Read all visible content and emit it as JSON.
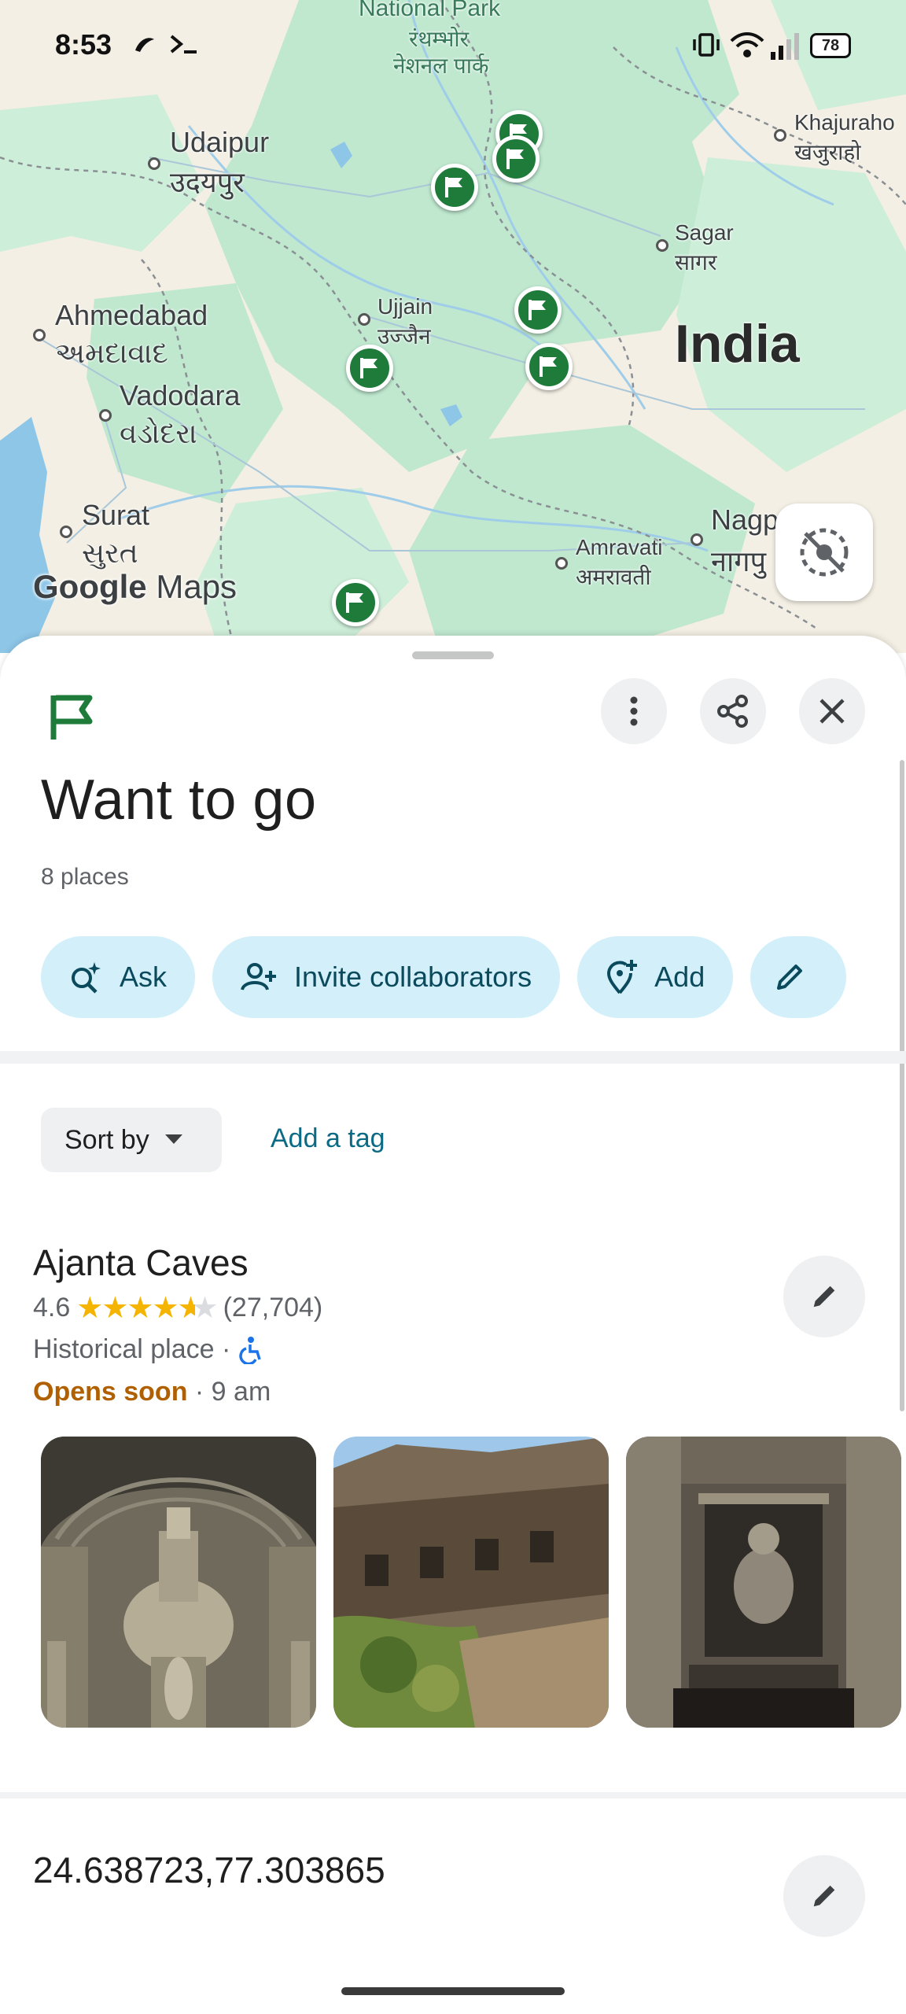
{
  "status_bar": {
    "time": "8:53",
    "battery": "78"
  },
  "map": {
    "country_label": "India",
    "cities": [
      {
        "name": "Udaipur",
        "native": "उदयपुर"
      },
      {
        "name": "Ahmedabad",
        "native": "અમદાવાદ"
      },
      {
        "name": "Vadodara",
        "native": "વડોદરા"
      },
      {
        "name": "Surat",
        "native": "સુરત"
      },
      {
        "name": "Ujjain",
        "native": "उज्जैन"
      },
      {
        "name": "Sagar",
        "native": "सागर"
      },
      {
        "name": "Khajuraho",
        "native": "खजुराहो"
      },
      {
        "name": "Amravati",
        "native": "अमरावती"
      },
      {
        "name": "Nagpur",
        "native": "नागपुर",
        "visible_name": "Nagp",
        "visible_native": "नागपु"
      }
    ],
    "park": {
      "name": "National Park",
      "native_1": "रंथम्भोर",
      "native_2": "नेशनल पार्क"
    },
    "logo": {
      "google": "Google",
      "maps": "Maps"
    },
    "colors": {
      "land": "#f3efe4",
      "green": "#bfe8cf",
      "water": "#8ec6e8",
      "pin": "#1e7b3a"
    }
  },
  "sheet": {
    "list_title": "Want to go",
    "place_count": "8 places",
    "icons": {
      "list": "flag-icon",
      "more": "more-vert-icon",
      "share": "share-icon",
      "close": "close-icon"
    },
    "chips": [
      {
        "label": "Ask",
        "icon": "ask-sparkle-icon"
      },
      {
        "label": "Invite collaborators",
        "icon": "person-add-icon"
      },
      {
        "label": "Add",
        "icon": "add-place-icon"
      },
      {
        "label": "",
        "icon": "pencil-icon"
      }
    ],
    "sort_label": "Sort by",
    "add_tag_label": "Add a tag",
    "places": [
      {
        "name": "Ajanta Caves",
        "rating": "4.6",
        "rating_value": 4.6,
        "reviews": "(27,704)",
        "type": "Historical place ·",
        "status": "Opens soon",
        "hours": " · 9 am",
        "photos": [
          "cave-interior-stupa-photo",
          "cliff-caves-photo",
          "cave-buddha-shrine-photo"
        ]
      },
      {
        "name": "24.638723,77.303865"
      }
    ],
    "accent": "#0b6b84",
    "chip_bg": "#d3f0fa",
    "open_soon_color": "#b06000"
  }
}
